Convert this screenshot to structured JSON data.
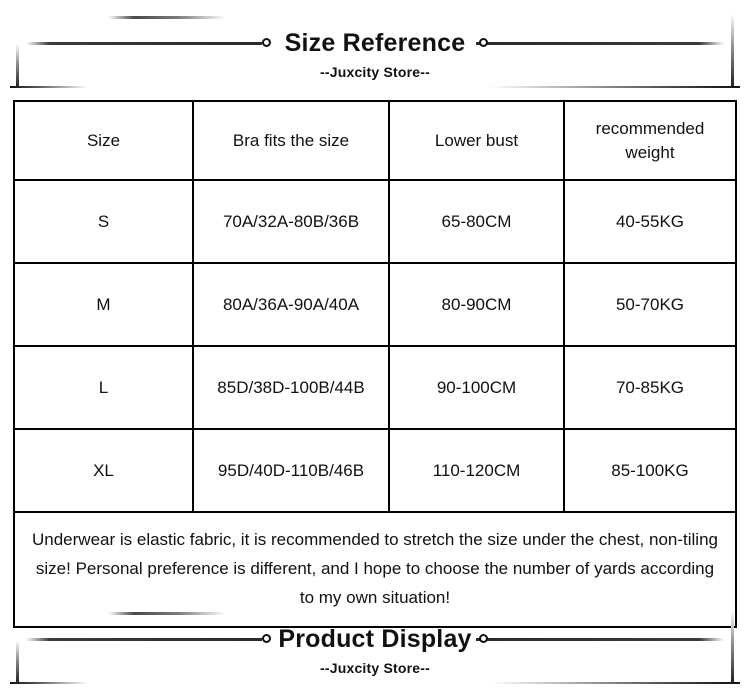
{
  "header": {
    "title": "Size Reference",
    "subtitle": "--Juxcity Store--"
  },
  "table": {
    "columns": [
      "Size",
      "Bra fits the size",
      "Lower bust",
      "recommended weight"
    ],
    "rows": [
      {
        "size": "S",
        "bra": "70A/32A-80B/36B",
        "lower_bust": "65-80CM",
        "weight": "40-55KG"
      },
      {
        "size": "M",
        "bra": "80A/36A-90A/40A",
        "lower_bust": "80-90CM",
        "weight": "50-70KG"
      },
      {
        "size": "L",
        "bra": "85D/38D-100B/44B",
        "lower_bust": "90-100CM",
        "weight": "70-85KG"
      },
      {
        "size": "XL",
        "bra": "95D/40D-110B/46B",
        "lower_bust": "110-120CM",
        "weight": "85-100KG"
      }
    ],
    "note": "Underwear is elastic fabric, it is recommended to stretch the size under the chest, non-tiling size! Personal preference is different, and I hope to choose the number of yards according to my own situation!"
  },
  "footer": {
    "title": "Product Display",
    "subtitle": "--Juxcity Store--"
  },
  "colors": {
    "text": "#111111",
    "border": "#000000",
    "background": "#ffffff"
  }
}
